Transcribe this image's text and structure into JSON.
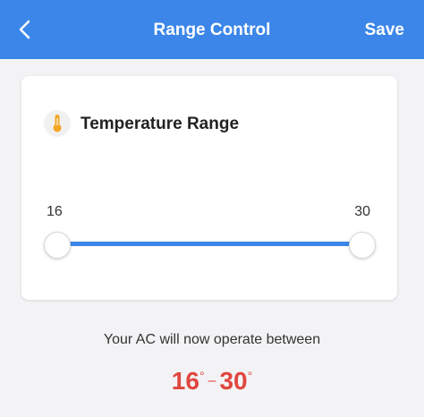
{
  "header": {
    "back_icon": "chevron-left-icon",
    "title": "Range Control",
    "save_label": "Save",
    "background_color": "#3b86e8"
  },
  "card": {
    "icon": "thermometer-icon",
    "title": "Temperature Range",
    "slider": {
      "min_label": "16",
      "max_label": "30",
      "min_value": 16,
      "max_value": 30,
      "track_color": "#3b86e8"
    }
  },
  "summary": {
    "text": "Your AC will now operate between",
    "low": "16",
    "high": "30",
    "degree_symbol": "°",
    "dash": "–",
    "accent_color": "#e0473f"
  }
}
